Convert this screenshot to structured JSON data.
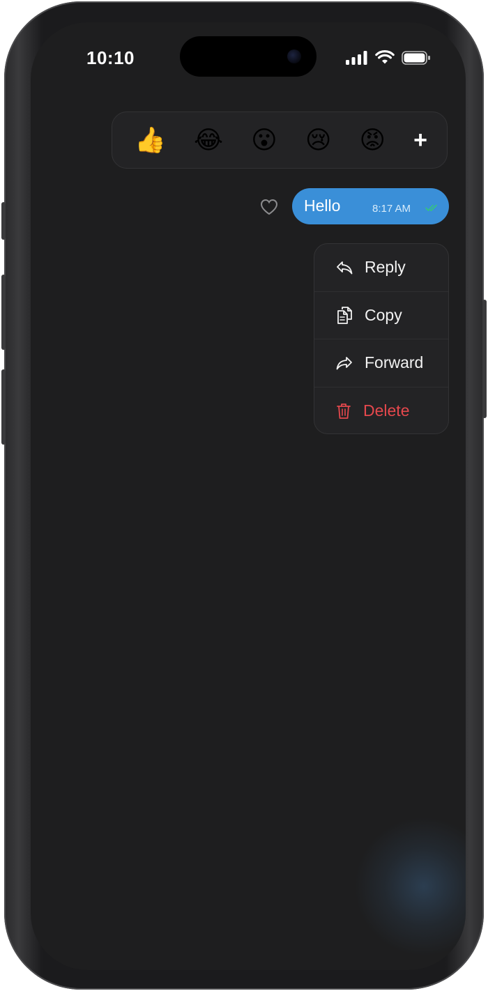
{
  "status_bar": {
    "time": "10:10",
    "icons": [
      "cellular-signal-icon",
      "wifi-icon",
      "battery-icon"
    ]
  },
  "reactions": {
    "items": [
      {
        "name": "thumbs-up-emoji",
        "glyph": "👍"
      },
      {
        "name": "laughing-emoji",
        "glyph": "😂"
      },
      {
        "name": "surprised-emoji",
        "glyph": "😮"
      },
      {
        "name": "crying-emoji",
        "glyph": "😢"
      },
      {
        "name": "angry-emoji",
        "glyph": "😡"
      }
    ],
    "more_label": "+"
  },
  "message": {
    "text": "Hello",
    "time": "8:17 AM",
    "status_icon": "double-check-icon",
    "bubble_color": "#3a8fd8",
    "check_color": "#34c77b",
    "heart_icon": "heart-outline-icon"
  },
  "context_menu": {
    "items": [
      {
        "icon": "reply-icon",
        "label": "Reply"
      },
      {
        "icon": "copy-icon",
        "label": "Copy"
      },
      {
        "icon": "forward-icon",
        "label": "Forward"
      },
      {
        "icon": "trash-icon",
        "label": "Delete"
      }
    ],
    "danger_color": "#e5484d"
  },
  "colors": {
    "screen_background": "#1e1e1f",
    "panel_background": "#232325"
  }
}
